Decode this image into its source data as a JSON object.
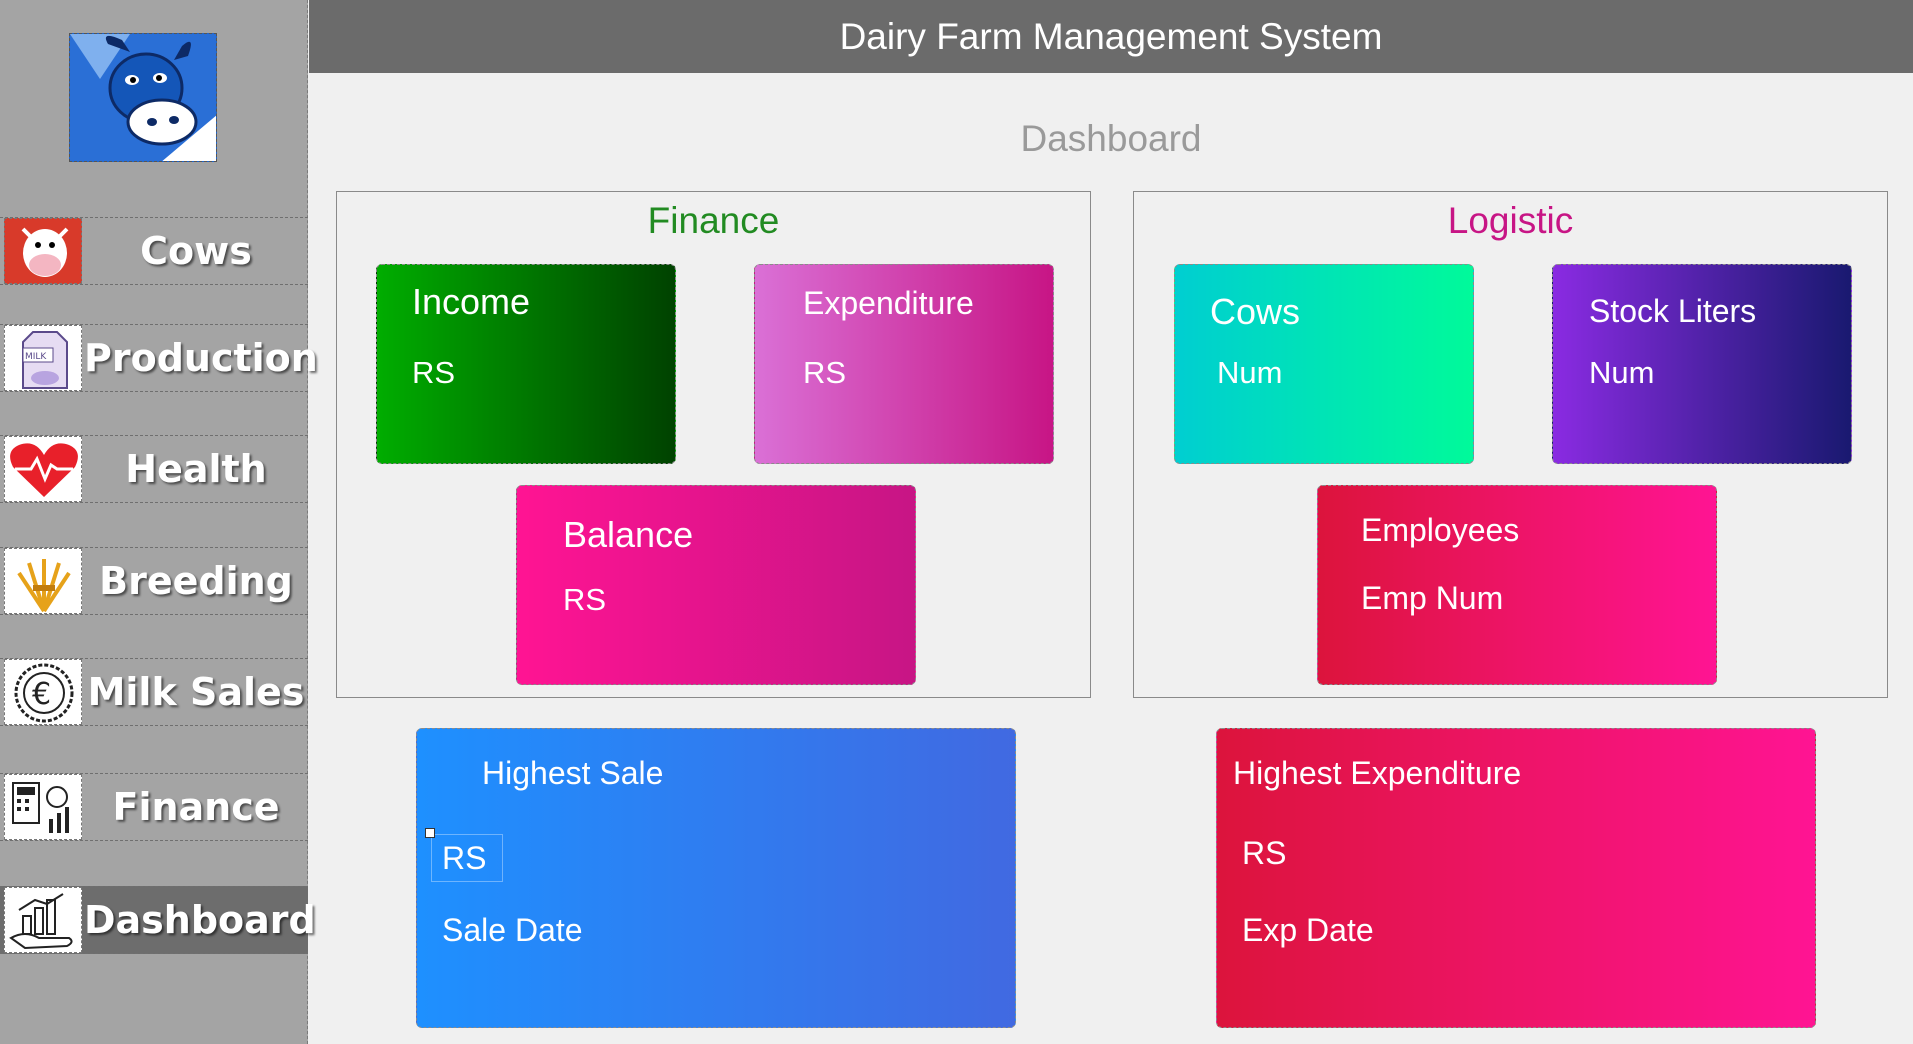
{
  "header": {
    "title": "Dairy Farm Management System"
  },
  "page": {
    "title": "Dashboard"
  },
  "sidebar": {
    "items": [
      {
        "label": "Cows",
        "icon": "cow-icon"
      },
      {
        "label": "Production",
        "icon": "milk-carton-icon"
      },
      {
        "label": "Health",
        "icon": "heart-pulse-icon"
      },
      {
        "label": "Breeding",
        "icon": "wheat-icon"
      },
      {
        "label": "Milk Sales",
        "icon": "euro-coin-icon"
      },
      {
        "label": "Finance",
        "icon": "calculator-chart-icon"
      },
      {
        "label": "Dashboard",
        "icon": "growth-chart-icon"
      }
    ],
    "active": "Dashboard"
  },
  "finance": {
    "title": "Finance",
    "title_color": "#228b22",
    "income": {
      "label": "Income",
      "value": "RS"
    },
    "expenditure": {
      "label": "Expenditure",
      "value": "RS"
    },
    "balance": {
      "label": "Balance",
      "value": "RS"
    }
  },
  "logistic": {
    "title": "Logistic",
    "title_color": "#c71585",
    "cows": {
      "label": "Cows",
      "value": "Num"
    },
    "stock": {
      "label": "Stock Liters",
      "value": "Num"
    },
    "employees": {
      "label": "Employees",
      "value": "Emp Num"
    }
  },
  "highest_sale": {
    "label": "Highest Sale",
    "value": "RS",
    "date": "Sale Date"
  },
  "highest_expenditure": {
    "label": "Highest Expenditure",
    "value": "RS",
    "date": "Exp Date"
  },
  "colors": {
    "sidebar_bg": "#a4a4a4",
    "header_bg": "#6b6b6b",
    "content_bg": "#f0f0f0"
  }
}
